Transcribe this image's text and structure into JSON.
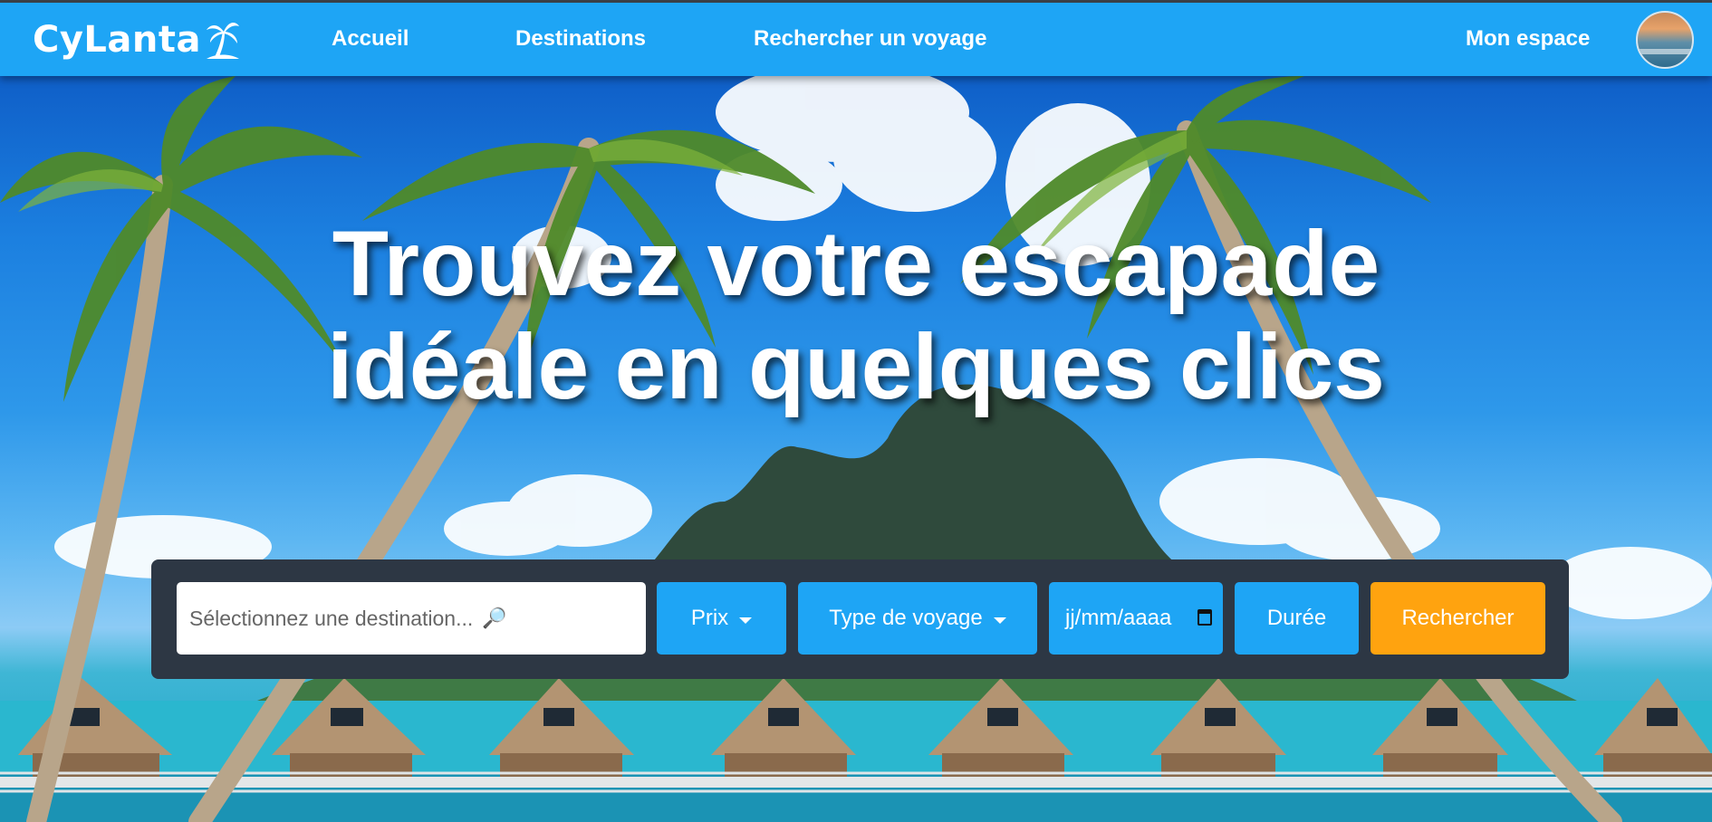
{
  "brand": {
    "name": "CyLanta",
    "logo_icon": "palm-tree-icon"
  },
  "nav": {
    "links": [
      {
        "label": "Accueil"
      },
      {
        "label": "Destinations"
      },
      {
        "label": "Rechercher un voyage"
      }
    ],
    "account_label": "Mon espace",
    "avatar": "user-avatar"
  },
  "hero": {
    "headline_line1": "Trouvez votre escapade",
    "headline_line2": "idéale en quelques clics"
  },
  "search": {
    "destination_placeholder": "Sélectionnez une destination...",
    "destination_icon": "magnifier-icon",
    "prix_label": "Prix",
    "type_label": "Type de voyage",
    "date_placeholder": "jj/mm/aaaa",
    "duree_label": "Durée",
    "submit_label": "Rechercher"
  },
  "colors": {
    "nav_bg": "#1ea5f5",
    "panel_bg": "#2d3744",
    "button_blue": "#1ea5f5",
    "search_button": "#ffa30f"
  }
}
